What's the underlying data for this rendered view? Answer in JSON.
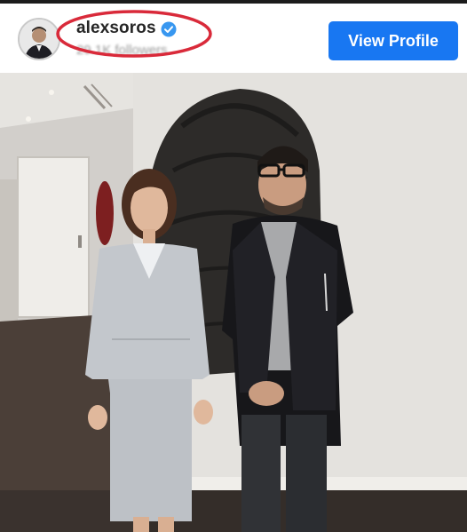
{
  "post": {
    "username": "alexsoros",
    "followers_text": "29.1K followers",
    "verified": true,
    "view_profile_label": "View Profile"
  },
  "colors": {
    "brand_blue": "#1877f2",
    "highlight_red": "#d92a3a",
    "verified_blue": "#3897f0"
  },
  "icons": {
    "avatar": "profile-avatar",
    "verified": "verified-badge-icon"
  }
}
